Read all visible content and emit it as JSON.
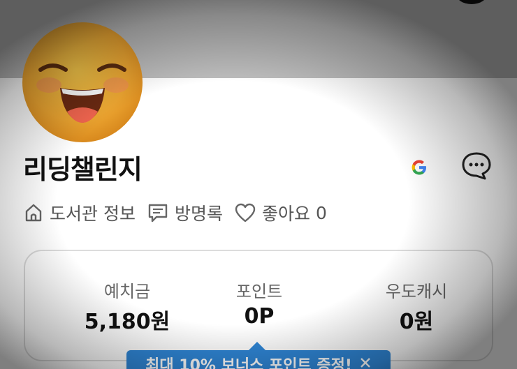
{
  "profile": {
    "name": "리딩챌린지",
    "avatar_icon": "grinning-face-emoji"
  },
  "header_actions": {
    "google_icon": "google-logo-icon",
    "chat_icon": "chat-bubble-icon"
  },
  "meta": {
    "library_info": "도서관 정보",
    "guestbook": "방명록",
    "likes_label": "좋아요",
    "likes_count": "0"
  },
  "stats": [
    {
      "label": "예치금",
      "value": "5,180원"
    },
    {
      "label": "포인트",
      "value": "0P"
    },
    {
      "label": "우도캐시",
      "value": "0원"
    }
  ],
  "promo": {
    "text": "최대 10% 보너스 포인트 증정!",
    "close_icon": "close-icon"
  },
  "colors": {
    "accent": "#2f86d6",
    "top_band": "#bdbdbd"
  }
}
